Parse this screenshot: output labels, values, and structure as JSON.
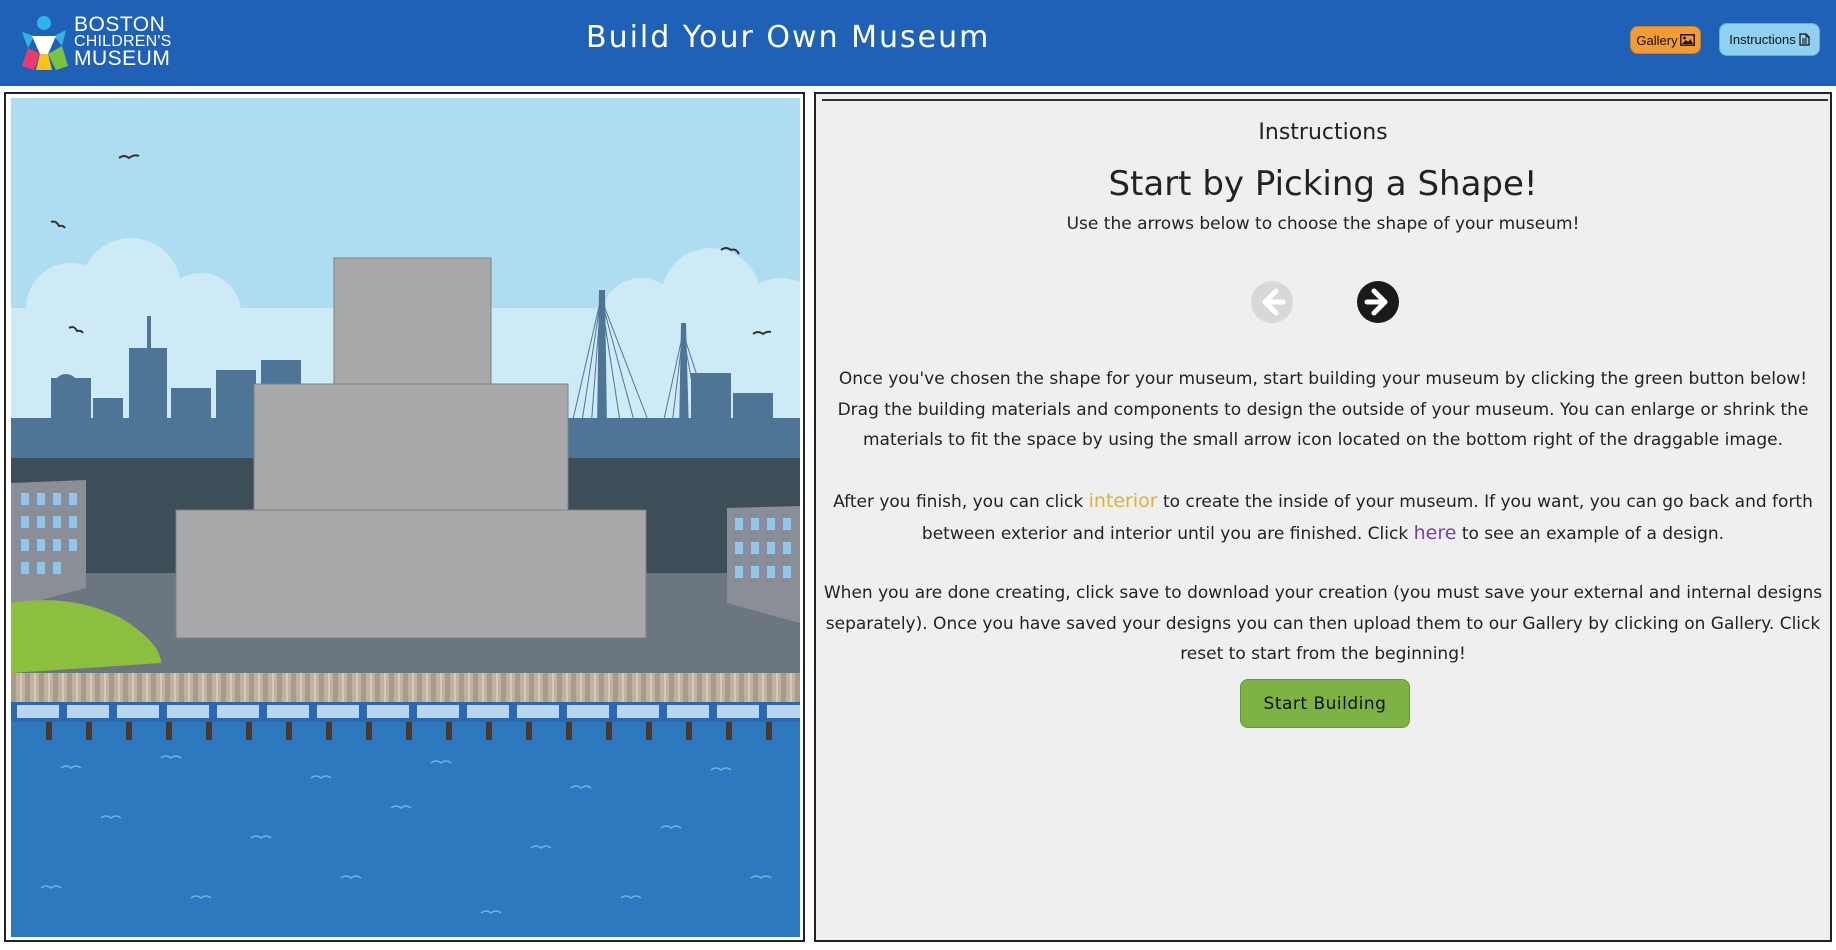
{
  "header": {
    "logo": {
      "line1": "BOSTON",
      "line2": "CHILDREN'S",
      "line3": "MUSEUM"
    },
    "title": "Build Your Own Museum",
    "gallery_label": "Gallery",
    "instructions_label": "Instructions"
  },
  "panel": {
    "heading": "Instructions",
    "title": "Start by Picking a Shape!",
    "subtitle": "Use the arrows below to choose the shape of your museum!",
    "para1": "Once you've chosen the shape for your museum, start building your museum by clicking the green button below! Drag the building materials and components to design the outside of your museum. You can enlarge or shrink the materials to fit the space by using the small arrow icon located on the bottom right of the draggable image.",
    "para2_a": "After you finish, you can click ",
    "para2_link1": "interior",
    "para2_b": " to create the inside of your museum. If you want, you can go back and forth between exterior and interior until you are finished. Click ",
    "para2_link2": "here",
    "para2_c": " to see an example of a design.",
    "para3": "When you are done creating, click save to download your creation (you must save your external and internal designs separately). Once you have saved your designs you can then upload them to our Gallery by clicking on Gallery. Click reset to start from the beginning!",
    "start_label": "Start Building"
  },
  "colors": {
    "header_bg": "#2061b8",
    "gallery_bg": "#f39c34",
    "instructions_bg": "#8fd1ee",
    "start_bg": "#7cb342",
    "interior_link": "#d6b633",
    "here_link": "#7a3cb0"
  },
  "icons": {
    "gallery": "image-icon",
    "instructions": "document-icon",
    "prev": "arrow-left-circle-icon",
    "next": "arrow-right-circle-icon"
  }
}
